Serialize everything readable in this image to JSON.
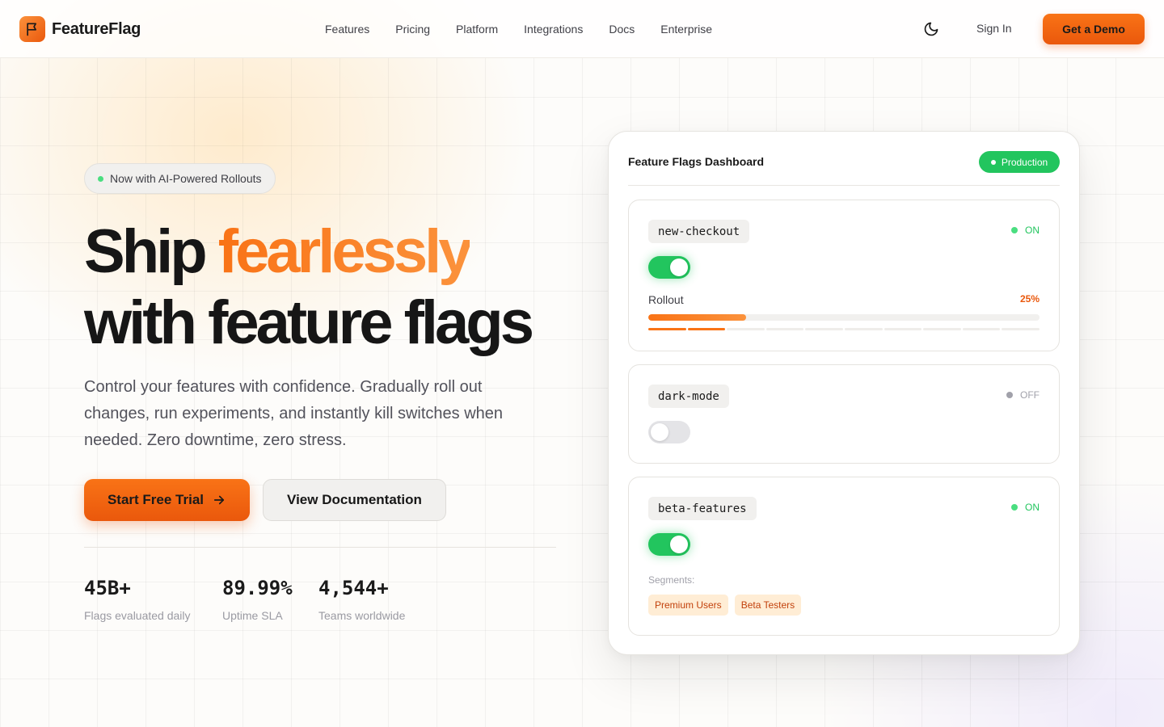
{
  "brand": {
    "name": "FeatureFlag",
    "accent": "#f97316",
    "success": "#22c55e"
  },
  "nav": {
    "items": [
      "Features",
      "Pricing",
      "Platform",
      "Integrations",
      "Docs",
      "Enterprise"
    ]
  },
  "header": {
    "theme_icon": "moon-icon",
    "sign_in": "Sign In",
    "demo": "Get a Demo"
  },
  "hero": {
    "badge": "Now with AI-Powered Rollouts",
    "headline_part1": "Ship ",
    "headline_accent": "fearlessly",
    "headline_line2": "with feature flags",
    "description": "Control your features with confidence. Gradually roll out changes, run experiments, and instantly kill switches when needed. Zero downtime, zero stress.",
    "primary_cta": "Start Free Trial",
    "secondary_cta": "View Documentation",
    "stats": [
      {
        "value": "45B+",
        "label": "Flags evaluated daily"
      },
      {
        "value": "89.99%",
        "label": "Uptime SLA"
      },
      {
        "value": "4,544+",
        "label": "Teams worldwide"
      }
    ]
  },
  "dashboard": {
    "title": "Feature Flags Dashboard",
    "environment": "Production",
    "flags": [
      {
        "key": "new-checkout",
        "status": "ON",
        "enabled": true,
        "rollout_label": "Rollout",
        "rollout_text": "25%",
        "rollout_percent": 25
      },
      {
        "key": "dark-mode",
        "status": "OFF",
        "enabled": false
      },
      {
        "key": "beta-features",
        "status": "ON",
        "enabled": true,
        "segments_label": "Segments:",
        "segments": [
          "Premium Users",
          "Beta Testers"
        ]
      }
    ]
  }
}
